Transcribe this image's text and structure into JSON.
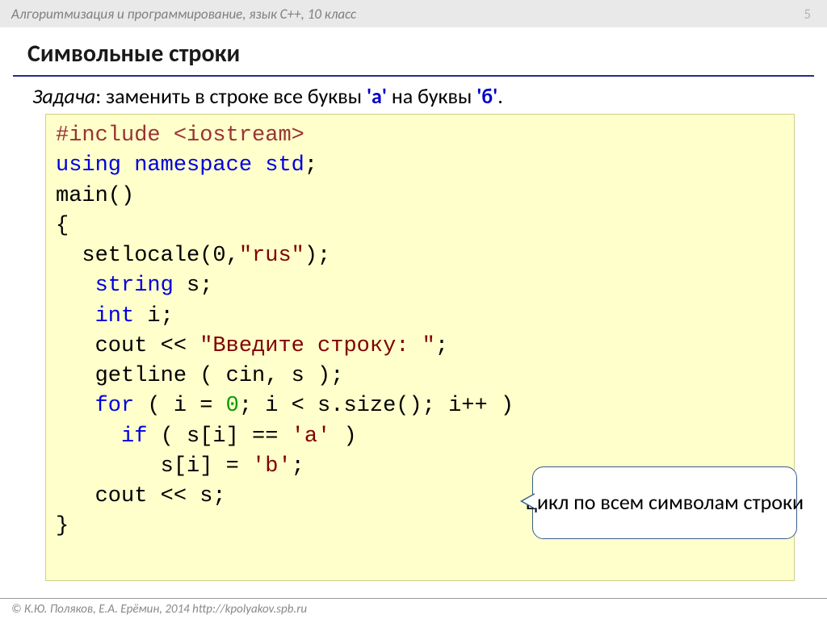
{
  "header": {
    "course": "Алгоритмизация и программирование, язык С++, 10 класс",
    "page": "5"
  },
  "title": "Символьные строки",
  "task": {
    "label": "Задача",
    "text_before": ": заменить в строке все буквы ",
    "ch1": "'а'",
    "text_mid": " на буквы ",
    "ch2": "'б'",
    "text_after": "."
  },
  "code": {
    "l1a": "#include ",
    "l1b": "<iostream>",
    "l2a": "using",
    "l2b": " namespace ",
    "l2c": "std",
    "l2d": ";",
    "l3": "main()",
    "l4": "{",
    "l5a": "  setlocale(0,",
    "l5b": "\"rus\"",
    "l5c": ");",
    "l6a": "   ",
    "l6b": "string",
    "l6c": " s;",
    "l7a": "   ",
    "l7b": "int",
    "l7c": " i;",
    "l8a": "   cout << ",
    "l8b": "\"Введите строку: \"",
    "l8c": ";",
    "l9": "   getline ( cin, s );",
    "l10a": "   ",
    "l10b": "for",
    "l10c": " ( i = ",
    "l10d": "0",
    "l10e": "; i < s.size(); i++ )",
    "l11a": "     ",
    "l11b": "if",
    "l11c": " ( s[i] == ",
    "l11d": "'а'",
    "l11e": " ) ",
    "l12a": "        s[i] = ",
    "l12b": "'b'",
    "l12c": ";",
    "l13": "   cout << s;",
    "l14": "}"
  },
  "callout": "цикл по всем символам строки",
  "footer": "© К.Ю. Поляков, Е.А. Ерёмин, 2014   http://kpolyakov.spb.ru"
}
